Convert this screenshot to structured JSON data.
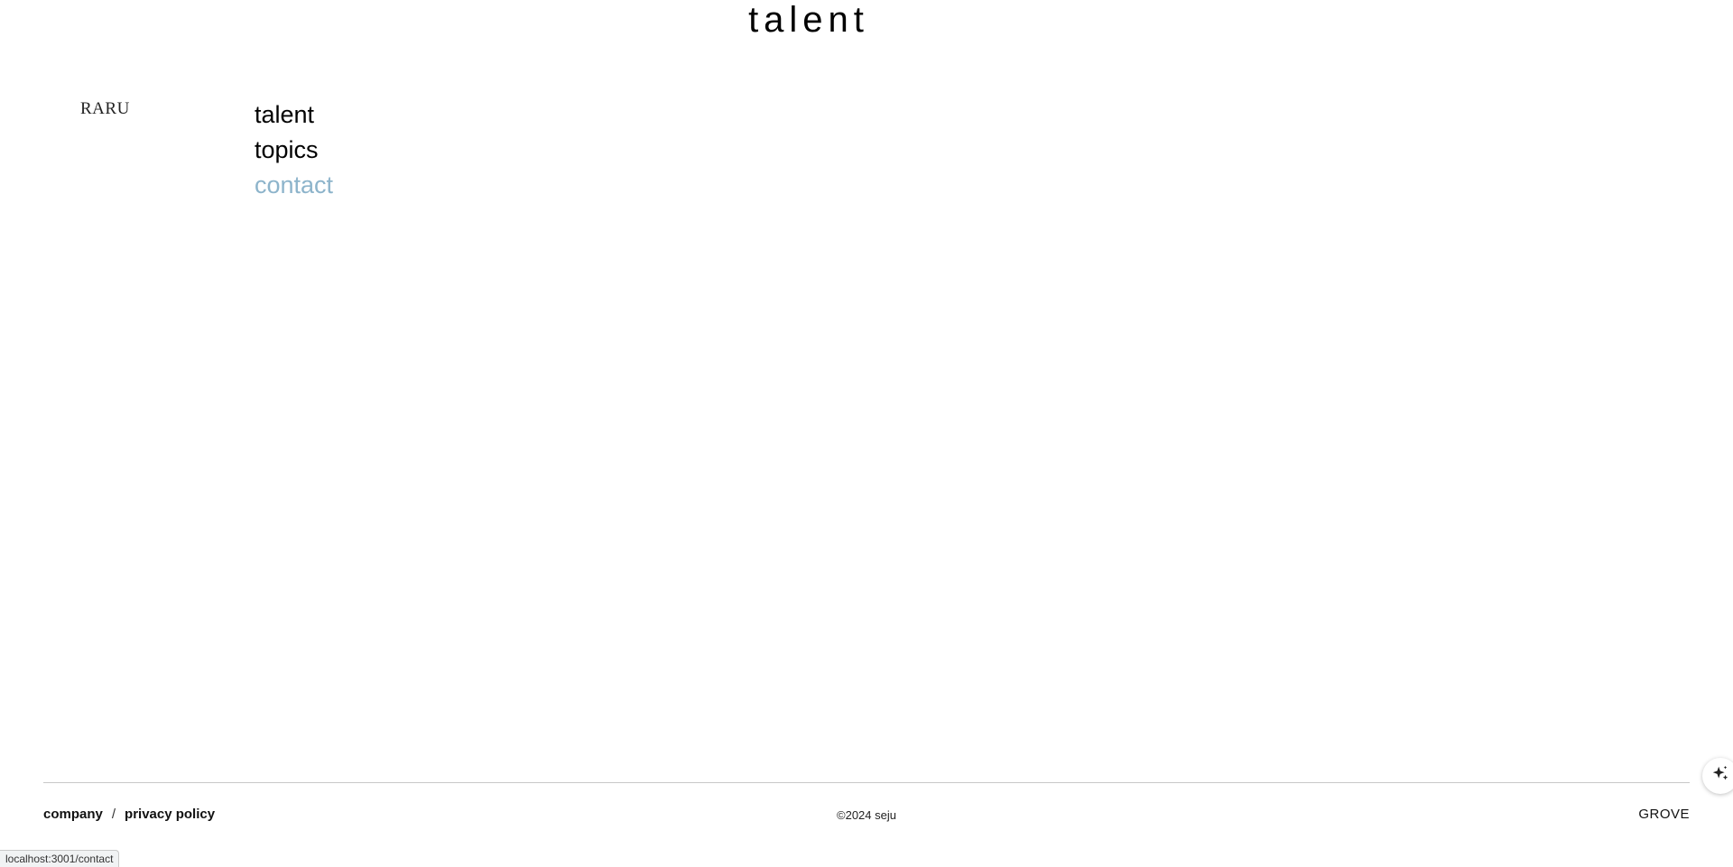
{
  "header": {
    "title": "talent"
  },
  "brand": {
    "label": "RARU"
  },
  "nav": {
    "items": [
      {
        "label": "talent"
      },
      {
        "label": "topics"
      },
      {
        "label": "contact"
      }
    ]
  },
  "footer": {
    "links": [
      {
        "label": "company"
      },
      {
        "label": "privacy policy"
      }
    ],
    "separator": "/",
    "copyright": "©2024 seju",
    "right_label": "GROVE"
  },
  "status_bar": {
    "url": "localhost:3001/contact"
  },
  "icons": {
    "assistant": "sparkle-icon"
  },
  "colors": {
    "active_nav": "#8db4cb",
    "text": "#000000",
    "rule": "#c8c8c8"
  }
}
